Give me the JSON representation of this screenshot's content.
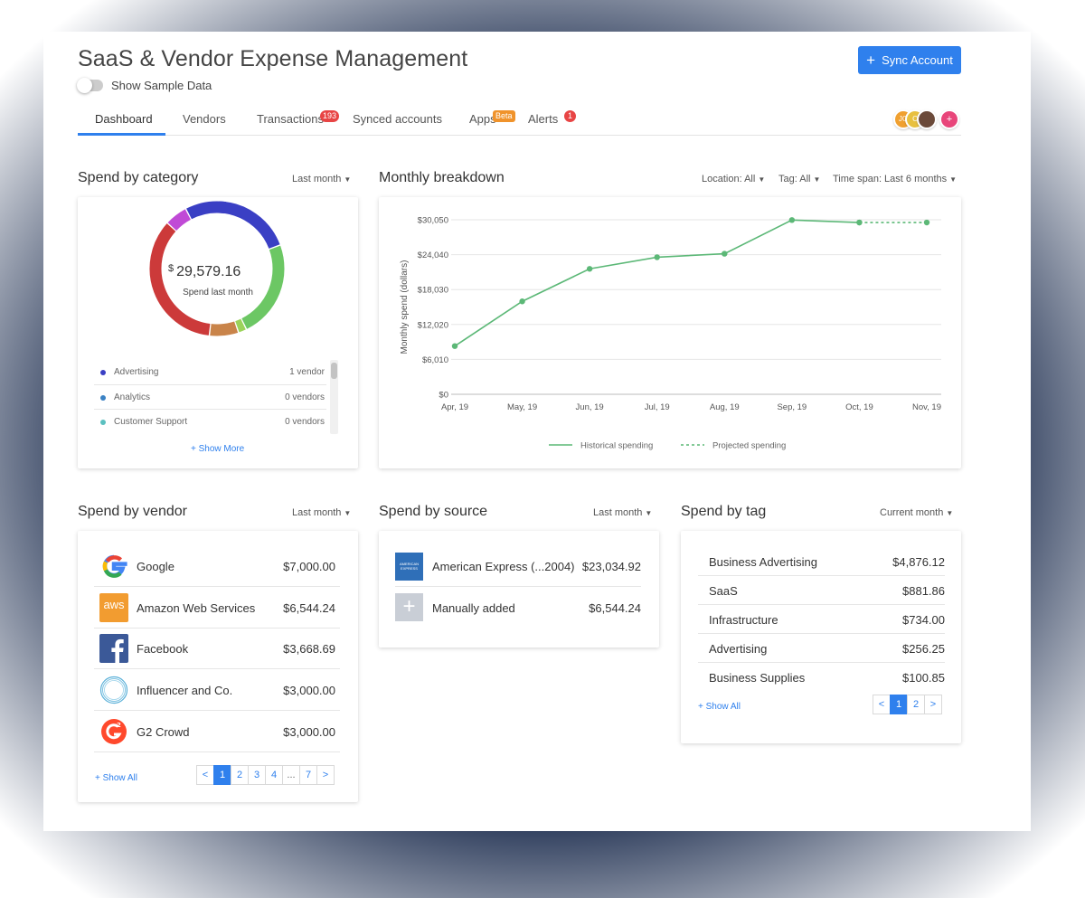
{
  "header": {
    "title": "SaaS & Vendor Expense Management",
    "sample_toggle_label": "Show Sample Data",
    "sync_button_label": "Sync Account",
    "sync_button_icon": "plus-icon"
  },
  "tabs": [
    {
      "label": "Dashboard",
      "active": true
    },
    {
      "label": "Vendors"
    },
    {
      "label": "Transactions",
      "badge": "193"
    },
    {
      "label": "Synced accounts"
    },
    {
      "label": "Apps",
      "badge": "Beta"
    },
    {
      "label": "Alerts",
      "badge": "1"
    }
  ],
  "avatars": [
    {
      "initials": "JG",
      "color": "#f0a030"
    },
    {
      "initials": "C",
      "color": "#e8c040"
    },
    {
      "initials": "",
      "color": "#6b4a3a"
    },
    {
      "initials": "+",
      "color": "#e8457a"
    }
  ],
  "spend_by_category": {
    "title": "Spend by category",
    "filter": "Last month",
    "currency_symbol": "$",
    "amount": "29,579.16",
    "amount_label": "Spend last month",
    "segments": [
      {
        "color": "#3a3fc4",
        "fraction": 0.19
      },
      {
        "color": "#6cc764",
        "fraction": 0.235
      },
      {
        "color": "#9bd35a",
        "fraction": 0.02
      },
      {
        "color": "#c9844a",
        "fraction": 0.07
      },
      {
        "color": "#cc3a3a",
        "fraction": 0.35
      },
      {
        "color": "#c04ad6",
        "fraction": 0.055
      },
      {
        "color": "#3a3fc4",
        "fraction": 0.1
      }
    ],
    "items": [
      {
        "name": "Advertising",
        "count": "1 vendor",
        "color": "#3a3fc4"
      },
      {
        "name": "Analytics",
        "count": "0 vendors",
        "color": "#3b82c4"
      },
      {
        "name": "Customer Support",
        "count": "0 vendors",
        "color": "#5bc0c0"
      }
    ],
    "show_more": "+ Show More"
  },
  "monthly_breakdown": {
    "title": "Monthly breakdown",
    "filters": [
      "Location: All",
      "Tag: All",
      "Time span: Last 6 months"
    ]
  },
  "chart_data": {
    "type": "line",
    "x": [
      "Apr, 19",
      "May, 19",
      "Jun, 19",
      "Jul, 19",
      "Aug, 19",
      "Sep, 19",
      "Oct, 19",
      "Nov, 19"
    ],
    "series": [
      {
        "name": "Historical spending",
        "values": [
          8300,
          16000,
          21600,
          23600,
          24200,
          30000,
          29579,
          null
        ],
        "color": "#5cb877",
        "style": "solid"
      },
      {
        "name": "Projected spending",
        "values": [
          null,
          null,
          null,
          null,
          null,
          null,
          29579,
          29579
        ],
        "color": "#5cb877",
        "style": "dashed"
      }
    ],
    "ylabel": "Monthly spend (dollars)",
    "yticks": [
      "$0",
      "$6,010",
      "$12,020",
      "$18,030",
      "$24,040",
      "$30,050"
    ],
    "ylim": [
      0,
      30050
    ],
    "grid": true,
    "legend": "bottom"
  },
  "spend_by_vendor": {
    "title": "Spend by vendor",
    "filter": "Last month",
    "vendors": [
      {
        "name": "Google",
        "amount": "$7,000.00",
        "logo": "google-logo"
      },
      {
        "name": "Amazon Web Services",
        "amount": "$6,544.24",
        "logo": "aws-logo"
      },
      {
        "name": "Facebook",
        "amount": "$3,668.69",
        "logo": "facebook-logo"
      },
      {
        "name": "Influencer and Co.",
        "amount": "$3,000.00",
        "logo": "influencer-logo"
      },
      {
        "name": "G2 Crowd",
        "amount": "$3,000.00",
        "logo": "g2-logo"
      }
    ],
    "aws_logo_text": "aws",
    "show_all": "+ Show All",
    "pages": [
      "<",
      "1",
      "2",
      "3",
      "4",
      "...",
      "7",
      ">"
    ]
  },
  "spend_by_source": {
    "title": "Spend by source",
    "filter": "Last month",
    "sources": [
      {
        "name": "American Express (...2004)",
        "amount": "$23,034.92",
        "logo_text": "AMERICAN EXPRESS"
      },
      {
        "name": "Manually added",
        "amount": "$6,544.24",
        "logo_text": "+"
      }
    ]
  },
  "spend_by_tag": {
    "title": "Spend by tag",
    "filter": "Current month",
    "tags": [
      {
        "name": "Business Advertising",
        "amount": "$4,876.12"
      },
      {
        "name": "SaaS",
        "amount": "$881.86"
      },
      {
        "name": "Infrastructure",
        "amount": "$734.00"
      },
      {
        "name": "Advertising",
        "amount": "$256.25"
      },
      {
        "name": "Business Supplies",
        "amount": "$100.85"
      }
    ],
    "show_all": "+ Show All",
    "pages": [
      "<",
      "1",
      "2",
      ">"
    ]
  }
}
